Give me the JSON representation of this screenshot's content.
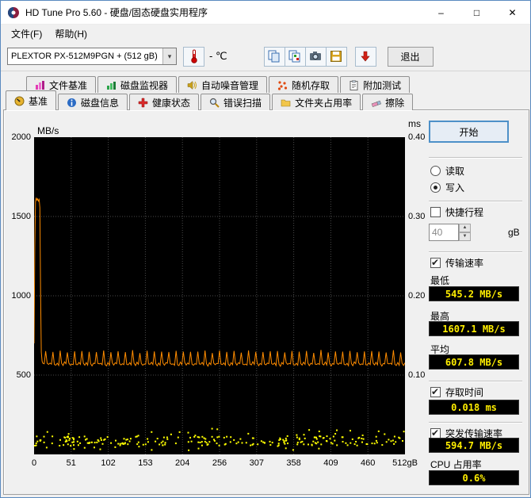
{
  "window": {
    "title": "HD Tune Pro 5.60 - 硬盘/固态硬盘实用程序",
    "minimize_glyph": "–",
    "maximize_glyph": "□",
    "close_glyph": "✕"
  },
  "menu": {
    "file": "文件(F)",
    "help": "帮助(H)"
  },
  "toolbar": {
    "drive_select": "PLEXTOR PX-512M9PGN + (512 gB)",
    "dropdown_glyph": "▾",
    "temperature": "- ℃",
    "exit_label": "退出"
  },
  "tabs": {
    "row1": [
      {
        "label": "文件基准"
      },
      {
        "label": "磁盘监视器"
      },
      {
        "label": "自动噪音管理"
      },
      {
        "label": "随机存取"
      },
      {
        "label": "附加测试"
      }
    ],
    "row2": [
      {
        "label": "基准",
        "active": true
      },
      {
        "label": "磁盘信息"
      },
      {
        "label": "健康状态"
      },
      {
        "label": "错误扫描"
      },
      {
        "label": "文件夹占用率"
      },
      {
        "label": "擦除"
      }
    ]
  },
  "controls": {
    "start_label": "开始",
    "read_label": "读取",
    "read_selected": false,
    "write_label": "写入",
    "write_selected": true,
    "short_stroke_label": "快捷行程",
    "short_stroke_checked": false,
    "short_stroke_value": "40",
    "short_stroke_unit": "gB",
    "spin_up_glyph": "▲",
    "spin_down_glyph": "▼",
    "transfer_label": "传输速率",
    "transfer_checked": true,
    "min_label": "最低",
    "min_value": "545.2 MB/s",
    "max_label": "最高",
    "max_value": "1607.1 MB/s",
    "avg_label": "平均",
    "avg_value": "607.8 MB/s",
    "access_label": "存取时间",
    "access_checked": true,
    "access_value": "0.018 ms",
    "burst_label": "突发传输速率",
    "burst_checked": true,
    "burst_value": "594.7 MB/s",
    "cpu_label": "CPU 占用率",
    "cpu_value": "0.6%"
  },
  "chart_data": {
    "type": "line",
    "title": "HD Tune Pro 写入基准测试",
    "x_max": 512,
    "x_ticks": [
      "0",
      "51",
      "102",
      "153",
      "204",
      "256",
      "307",
      "358",
      "409",
      "460",
      "512gB"
    ],
    "left_axis": {
      "unit": "MB/s",
      "max": 2000,
      "ticks": [
        "2000",
        "1500",
        "1000",
        "500"
      ]
    },
    "right_axis": {
      "unit": "ms",
      "max": 0.4,
      "ticks": [
        "0.40",
        "0.30",
        "0.20",
        "0.10"
      ]
    },
    "grid": true,
    "plot_bg": "#000000",
    "grid_color": "#4a4a4a",
    "series": [
      {
        "name": "write-transfer-rate",
        "unit": "MB/s",
        "color": "#ff8c00",
        "stats": {
          "min": 545.2,
          "max": 1607.1,
          "avg": 607.8
        },
        "lead_in_points": [
          [
            0,
            700
          ],
          [
            1,
            1300
          ],
          [
            2,
            1595
          ],
          [
            3,
            1618
          ],
          [
            4,
            1602
          ],
          [
            5,
            1611
          ],
          [
            6,
            1597
          ],
          [
            7,
            1607
          ],
          [
            8,
            1555
          ],
          [
            9,
            1020
          ],
          [
            10,
            645
          ],
          [
            11,
            588
          ]
        ],
        "pattern_start_x": 12,
        "pattern_dx": 2,
        "baseline_pattern": [
          575,
          566,
          652,
          571,
          562,
          578,
          568,
          645,
          573,
          564
        ]
      },
      {
        "name": "access-time",
        "unit": "ms",
        "color": "#ffff00",
        "band": {
          "min_ms": 0.006,
          "max_ms": 0.034,
          "avg_ms": 0.018
        },
        "dot_count": 260
      }
    ]
  }
}
